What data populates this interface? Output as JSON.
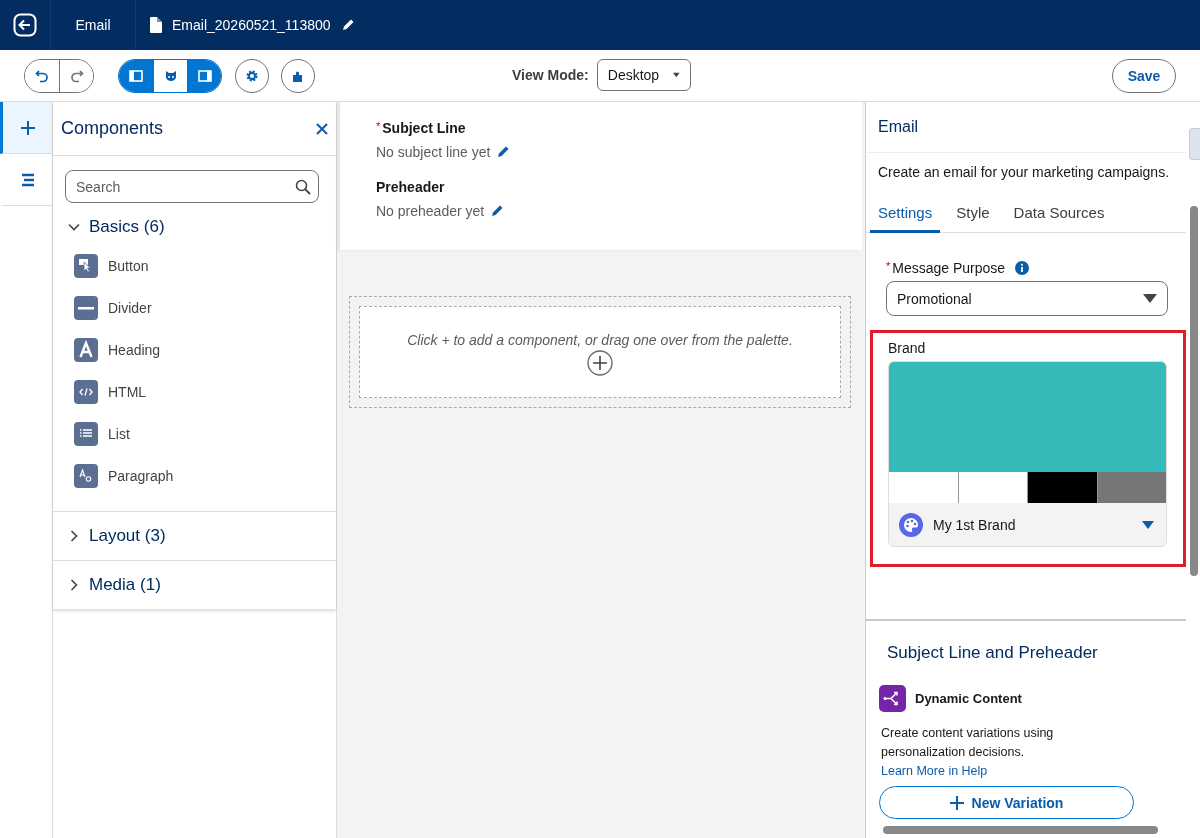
{
  "header": {
    "section": "Email",
    "file_name": "Email_20260521_113800"
  },
  "toolbar": {
    "view_toggles": [
      {
        "kind": "left-panel",
        "selected": true
      },
      {
        "kind": "face",
        "selected": false
      },
      {
        "kind": "right-panel",
        "selected": true
      }
    ],
    "view_mode": {
      "label": "View Mode:",
      "value": "Desktop"
    },
    "save": "Save"
  },
  "rail": [
    {
      "kind": "add",
      "selected": true
    },
    {
      "kind": "outline",
      "selected": false
    }
  ],
  "components_panel": {
    "title": "Components",
    "search": {
      "placeholder": "Search"
    },
    "groups": [
      {
        "label": "Basics (6)",
        "expanded": true,
        "items": [
          {
            "kind": "button",
            "label": "Button"
          },
          {
            "kind": "divider",
            "label": "Divider"
          },
          {
            "kind": "heading",
            "label": "Heading"
          },
          {
            "kind": "html",
            "label": "HTML"
          },
          {
            "kind": "list",
            "label": "List"
          },
          {
            "kind": "paragraph",
            "label": "Paragraph"
          }
        ]
      },
      {
        "label": "Layout (3)",
        "expanded": false
      },
      {
        "label": "Media (1)",
        "expanded": false
      }
    ]
  },
  "canvas": {
    "fields": [
      {
        "required_mark": "*",
        "label": "Subject Line",
        "value": "No subject line yet"
      },
      {
        "label": "Preheader",
        "value": "No preheader yet"
      }
    ],
    "dropzone": "Click + to add a component, or drag one over from the palette."
  },
  "properties": {
    "title": "Email",
    "description": "Create an email for your marketing campaigns.",
    "tabs": [
      {
        "label": "Settings",
        "selected": true
      },
      {
        "label": "Style",
        "selected": false
      },
      {
        "label": "Data Sources",
        "selected": false
      }
    ],
    "message_purpose": {
      "required_mark": "*",
      "label": "Message Purpose",
      "value": "Promotional"
    },
    "brand": {
      "label": "Brand",
      "highlighted": true,
      "palette": [
        {
          "kind": "primary",
          "color": "#36b9b9"
        },
        {
          "kind": "swatch",
          "color": "#ffffff"
        },
        {
          "kind": "swatch",
          "color": "#ffffff"
        },
        {
          "kind": "swatch",
          "color": "#000000"
        },
        {
          "kind": "swatch",
          "color": "#767676"
        }
      ],
      "name": "My 1st Brand"
    },
    "subject_section": {
      "title": "Subject Line and Preheader",
      "feature": "Dynamic Content",
      "description": "Create content variations using personalization decisions.",
      "link": "Learn More in Help",
      "button": "New Variation"
    }
  }
}
